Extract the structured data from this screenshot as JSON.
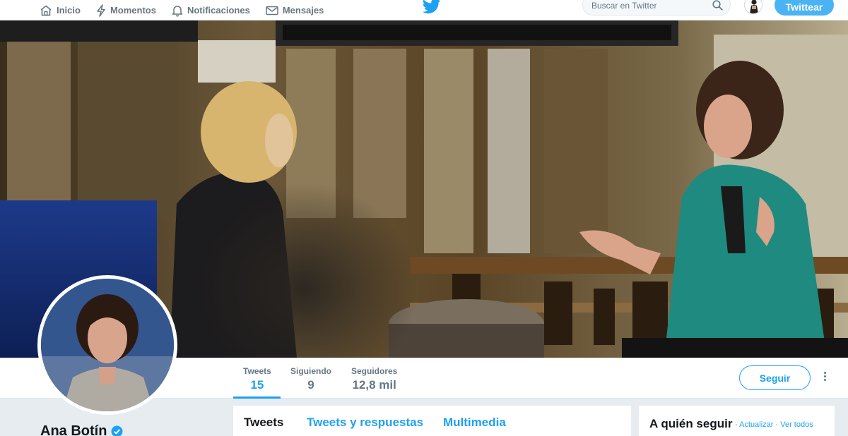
{
  "nav": {
    "items": [
      {
        "label": "Inicio",
        "icon": "home-icon"
      },
      {
        "label": "Momentos",
        "icon": "lightning-icon"
      },
      {
        "label": "Notificaciones",
        "icon": "bell-icon"
      },
      {
        "label": "Mensajes",
        "icon": "envelope-icon"
      }
    ],
    "logo_icon": "twitter-bird-icon",
    "search_placeholder": "Buscar en Twitter",
    "tweet_button": "Twittear"
  },
  "profile": {
    "name": "Ana Botín",
    "verified": true,
    "stats": [
      {
        "label": "Tweets",
        "value": "15",
        "active": true
      },
      {
        "label": "Siguiendo",
        "value": "9",
        "active": false
      },
      {
        "label": "Seguidores",
        "value": "12,8 mil",
        "active": false
      }
    ],
    "follow_button": "Seguir"
  },
  "timeline": {
    "tabs": [
      {
        "label": "Tweets",
        "active": true
      },
      {
        "label": "Tweets y respuestas",
        "active": false
      },
      {
        "label": "Multimedia",
        "active": false
      }
    ]
  },
  "who_to_follow": {
    "title": "A quién seguir",
    "separator": "·",
    "refresh": "Actualizar",
    "view_all": "Ver todos"
  },
  "colors": {
    "accent": "#1da1f2",
    "tweet_button_bg": "#4ab3f4",
    "page_bg": "#e6ecf0",
    "muted_text": "#657786"
  }
}
